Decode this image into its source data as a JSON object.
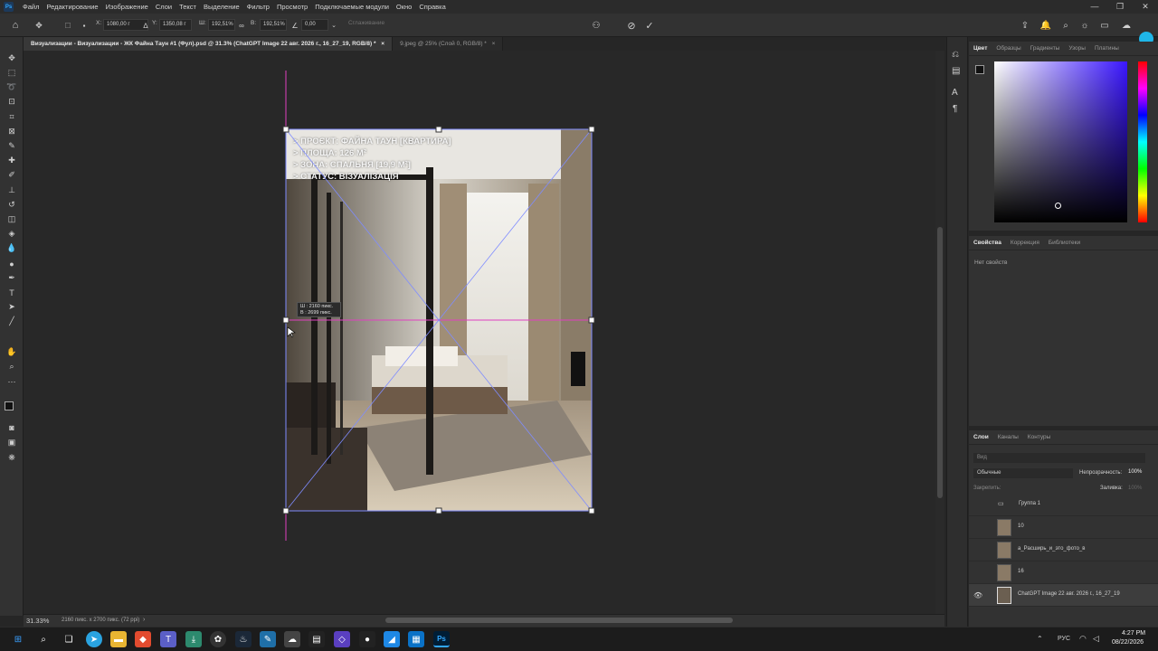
{
  "menubar": {
    "logo": "Ps",
    "items": [
      "Файл",
      "Редактирование",
      "Изображение",
      "Слои",
      "Текст",
      "Выделение",
      "Фильтр",
      "Просмотр",
      "Подключаемые модули",
      "Окно",
      "Справка"
    ]
  },
  "window_controls": [
    "—",
    "❐",
    "✕"
  ],
  "options": {
    "x_label": "X:",
    "x_value": "1080,00 г",
    "y_label": "Y:",
    "y_value": "1350,08 г",
    "w_label": "Ш:",
    "w_value": "192,51%",
    "h_label": "В:",
    "h_value": "192,51%",
    "angle_value": "0,00",
    "interp_label": "Сглаживание"
  },
  "tabs": [
    {
      "label": "Визуализации - Визуализации - ЖК Файна Таун #1 (Фул).psd @ 31.3% (ChatGPT Image 22 авг. 2026 г., 16_27_19, RGB/8) *",
      "close": "×"
    },
    {
      "label": "9.jpeg @ 25% (Слой 0, RGB/8) *",
      "close": "×"
    }
  ],
  "image_overlay": {
    "lines": [
      "> ПРОЄКТ: ФАЙНА ТАУН [КВАРТИРА]",
      "> ПЛОЩА: 126 М²",
      "> ЗОНА: СПАЛЬНЯ [19,9 М²]",
      "> СТАТУС: ВІЗУАЛІЗАЦІЯ"
    ]
  },
  "size_tooltip": {
    "w": "Ш : 2160 пикс.",
    "h": "В : 2699 пикс."
  },
  "status": {
    "zoom": "31.33%",
    "doc_info": "2160 пикс. x 2700 пикс. (72 ppi)"
  },
  "color_panel": {
    "tabs": [
      "Цвет",
      "Образцы",
      "Градиенты",
      "Узоры",
      "Платины"
    ]
  },
  "properties_panel": {
    "tabs": [
      "Свойства",
      "Коррекция",
      "Библиотеки"
    ],
    "empty_text": "Нет свойств"
  },
  "layers_panel": {
    "tabs": [
      "Слои",
      "Каналы",
      "Контуры"
    ],
    "search_placeholder": "Вид",
    "blend_mode": "Обычные",
    "opacity_label": "Непрозрачность:",
    "opacity_value": "100%",
    "lock_label": "Закрепить:",
    "fill_label": "Заливка:",
    "fill_value": "100%",
    "layers": [
      {
        "name": "Группа 1",
        "type": "group"
      },
      {
        "name": "10",
        "type": "image"
      },
      {
        "name": "а_Расширь_и_это_фото_в",
        "type": "image"
      },
      {
        "name": "16",
        "type": "image"
      },
      {
        "name": "ChatGPT Image 22 авг. 2026 г., 16_27_19",
        "type": "image",
        "selected": true
      }
    ]
  },
  "taskbar": {
    "lang": "РУС",
    "time": "4:27 PM",
    "date": "08/22/2026"
  }
}
